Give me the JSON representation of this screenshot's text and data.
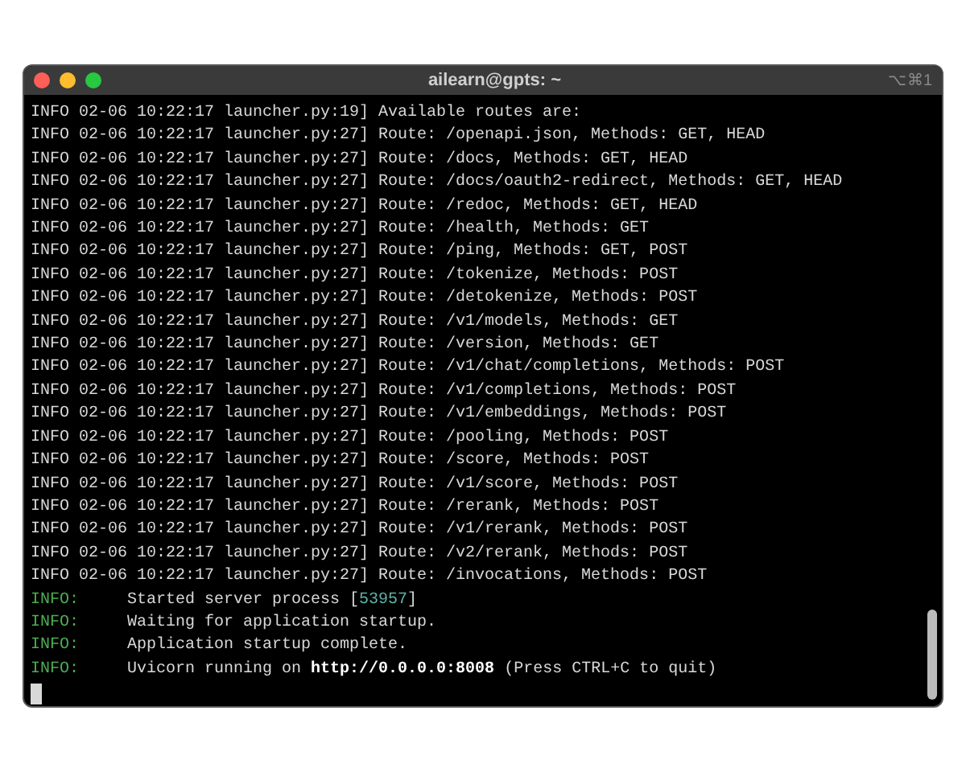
{
  "window": {
    "title": "ailearn@gpts: ~",
    "shortcut": "⌥⌘1"
  },
  "lines": [
    {
      "kind": "log",
      "text": "INFO 02-06 10:22:17 launcher.py:19] Available routes are:"
    },
    {
      "kind": "log",
      "text": "INFO 02-06 10:22:17 launcher.py:27] Route: /openapi.json, Methods: GET, HEAD"
    },
    {
      "kind": "log",
      "text": "INFO 02-06 10:22:17 launcher.py:27] Route: /docs, Methods: GET, HEAD"
    },
    {
      "kind": "log",
      "text": "INFO 02-06 10:22:17 launcher.py:27] Route: /docs/oauth2-redirect, Methods: GET, HEAD"
    },
    {
      "kind": "log",
      "text": "INFO 02-06 10:22:17 launcher.py:27] Route: /redoc, Methods: GET, HEAD"
    },
    {
      "kind": "log",
      "text": "INFO 02-06 10:22:17 launcher.py:27] Route: /health, Methods: GET"
    },
    {
      "kind": "log",
      "text": "INFO 02-06 10:22:17 launcher.py:27] Route: /ping, Methods: GET, POST"
    },
    {
      "kind": "log",
      "text": "INFO 02-06 10:22:17 launcher.py:27] Route: /tokenize, Methods: POST"
    },
    {
      "kind": "log",
      "text": "INFO 02-06 10:22:17 launcher.py:27] Route: /detokenize, Methods: POST"
    },
    {
      "kind": "log",
      "text": "INFO 02-06 10:22:17 launcher.py:27] Route: /v1/models, Methods: GET"
    },
    {
      "kind": "log",
      "text": "INFO 02-06 10:22:17 launcher.py:27] Route: /version, Methods: GET"
    },
    {
      "kind": "log",
      "text": "INFO 02-06 10:22:17 launcher.py:27] Route: /v1/chat/completions, Methods: POST"
    },
    {
      "kind": "log",
      "text": "INFO 02-06 10:22:17 launcher.py:27] Route: /v1/completions, Methods: POST"
    },
    {
      "kind": "log",
      "text": "INFO 02-06 10:22:17 launcher.py:27] Route: /v1/embeddings, Methods: POST"
    },
    {
      "kind": "log",
      "text": "INFO 02-06 10:22:17 launcher.py:27] Route: /pooling, Methods: POST"
    },
    {
      "kind": "log",
      "text": "INFO 02-06 10:22:17 launcher.py:27] Route: /score, Methods: POST"
    },
    {
      "kind": "log",
      "text": "INFO 02-06 10:22:17 launcher.py:27] Route: /v1/score, Methods: POST"
    },
    {
      "kind": "log",
      "text": "INFO 02-06 10:22:17 launcher.py:27] Route: /rerank, Methods: POST"
    },
    {
      "kind": "log",
      "text": "INFO 02-06 10:22:17 launcher.py:27] Route: /v1/rerank, Methods: POST"
    },
    {
      "kind": "log",
      "text": "INFO 02-06 10:22:17 launcher.py:27] Route: /v2/rerank, Methods: POST"
    },
    {
      "kind": "log",
      "text": "INFO 02-06 10:22:17 launcher.py:27] Route: /invocations, Methods: POST"
    },
    {
      "kind": "server",
      "level": "INFO:",
      "segments": [
        {
          "kind": "plain",
          "text": "Started server process ["
        },
        {
          "kind": "number",
          "text": "53957"
        },
        {
          "kind": "plain",
          "text": "]"
        }
      ]
    },
    {
      "kind": "server",
      "level": "INFO:",
      "segments": [
        {
          "kind": "plain",
          "text": "Waiting for application startup."
        }
      ]
    },
    {
      "kind": "server",
      "level": "INFO:",
      "segments": [
        {
          "kind": "plain",
          "text": "Application startup complete."
        }
      ]
    },
    {
      "kind": "server",
      "level": "INFO:",
      "segments": [
        {
          "kind": "plain",
          "text": "Uvicorn running on "
        },
        {
          "kind": "bold",
          "text": "http://0.0.0.0:8008"
        },
        {
          "kind": "plain",
          "text": " (Press CTRL+C to quit)"
        }
      ]
    }
  ]
}
